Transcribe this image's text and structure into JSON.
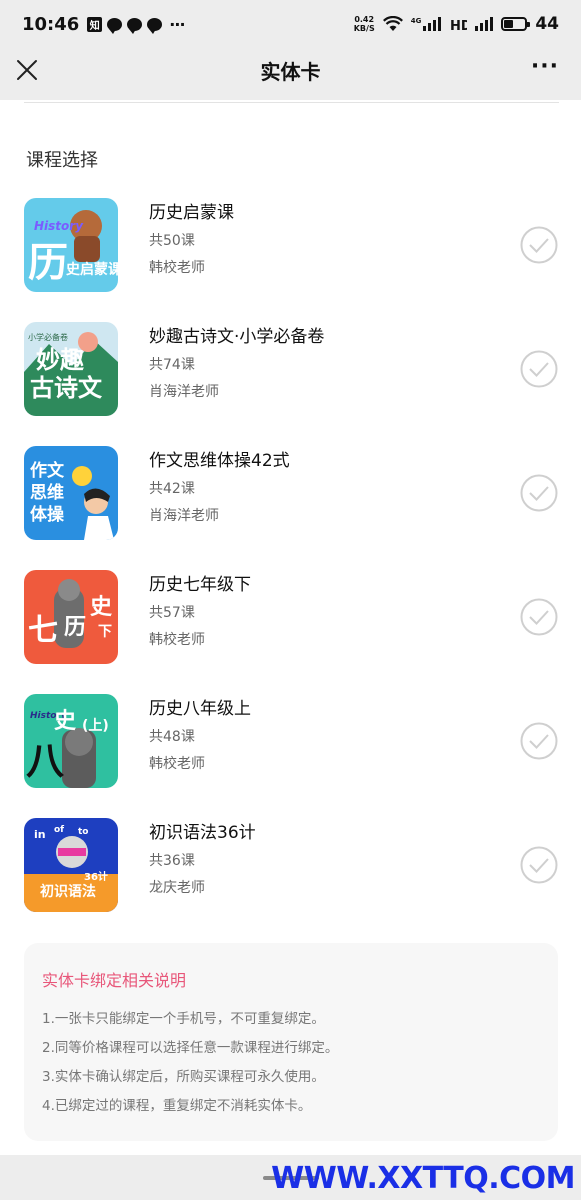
{
  "status_bar": {
    "time": "10:46",
    "app_badge": "知",
    "more": "···",
    "net_speed_value": "0.42",
    "net_speed_unit": "KB/S",
    "net_gen": "4G",
    "battery_level": "44"
  },
  "nav": {
    "title": "实体卡",
    "more": "···"
  },
  "section": {
    "title": "课程选择"
  },
  "courses": [
    {
      "title": "历史启蒙课",
      "count": "共50课",
      "teacher": "韩校老师",
      "thumb_color": "#64cbea"
    },
    {
      "title": "妙趣古诗文·小学必备卷",
      "count": "共74课",
      "teacher": "肖海洋老师",
      "thumb_color": "#2e8a5c"
    },
    {
      "title": "作文思维体操42式",
      "count": "共42课",
      "teacher": "肖海洋老师",
      "thumb_color": "#2a8fe0"
    },
    {
      "title": "历史七年级下",
      "count": "共57课",
      "teacher": "韩校老师",
      "thumb_color": "#ef5a3d"
    },
    {
      "title": "历史八年级上",
      "count": "共48课",
      "teacher": "韩校老师",
      "thumb_color": "#2fc0a0"
    },
    {
      "title": "初识语法36计",
      "count": "共36课",
      "teacher": "龙庆老师",
      "thumb_color": "#1e3fc0"
    }
  ],
  "thumb_text": {
    "c0_word": "History",
    "c0_big": "历",
    "c0_small": "史启蒙课",
    "c1_tag": "小学必备卷",
    "c1_line1": "妙趣",
    "c1_line2": "古诗文",
    "c2_line1": "作文",
    "c2_line2": "思维",
    "c2_line3": "体操",
    "c3_big": "七",
    "c3_mid": "历",
    "c3_side": "史",
    "c3_down": "下",
    "c4_word": "History",
    "c4_big": "八",
    "c4_mid": "史",
    "c4_up": "(上)",
    "c5_in": "in",
    "c5_of": "of",
    "c5_to": "to",
    "c5_num": "36计",
    "c5_title": "初识语法"
  },
  "notes": {
    "title": "实体卡绑定相关说明",
    "items": [
      "1.一张卡只能绑定一个手机号，不可重复绑定。",
      "2.同等价格课程可以选择任意一款课程进行绑定。",
      "3.实体卡确认绑定后，所购买课程可永久使用。",
      "4.已绑定过的课程，重复绑定不消耗实体卡。"
    ]
  },
  "watermark": "WWW.XXTTQ.COM",
  "colors": {
    "accent_pink": "#e8577a",
    "check_gray": "#cfcfcf",
    "watermark_blue": "#1a2fe6"
  }
}
